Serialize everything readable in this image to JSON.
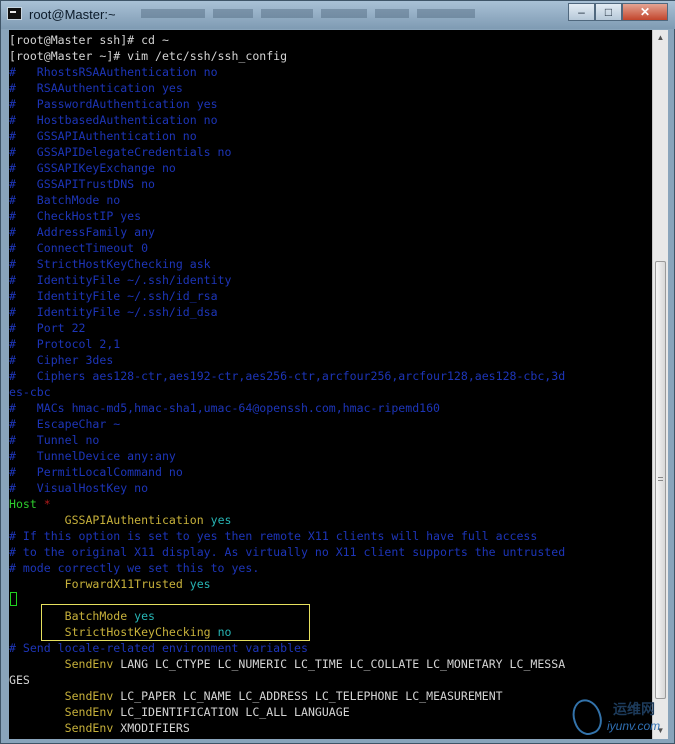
{
  "window": {
    "title": "root@Master:~"
  },
  "controls": {
    "minimize": "–",
    "maximize": "□",
    "close": "✕"
  },
  "scrollbar": {
    "up": "▲",
    "down": "▼"
  },
  "terminal": {
    "lines": [
      [
        [
          "w",
          "[root@Master ssh]# cd ~"
        ]
      ],
      [
        [
          "w",
          "[root@Master ~]# vim /etc/ssh/ssh_config"
        ]
      ],
      [
        [
          "c",
          "#   RhostsRSAAuthentication no"
        ]
      ],
      [
        [
          "c",
          "#   RSAAuthentication yes"
        ]
      ],
      [
        [
          "c",
          "#   PasswordAuthentication yes"
        ]
      ],
      [
        [
          "c",
          "#   HostbasedAuthentication no"
        ]
      ],
      [
        [
          "c",
          "#   GSSAPIAuthentication no"
        ]
      ],
      [
        [
          "c",
          "#   GSSAPIDelegateCredentials no"
        ]
      ],
      [
        [
          "c",
          "#   GSSAPIKeyExchange no"
        ]
      ],
      [
        [
          "c",
          "#   GSSAPITrustDNS no"
        ]
      ],
      [
        [
          "c",
          "#   BatchMode no"
        ]
      ],
      [
        [
          "c",
          "#   CheckHostIP yes"
        ]
      ],
      [
        [
          "c",
          "#   AddressFamily any"
        ]
      ],
      [
        [
          "c",
          "#   ConnectTimeout 0"
        ]
      ],
      [
        [
          "c",
          "#   StrictHostKeyChecking ask"
        ]
      ],
      [
        [
          "c",
          "#   IdentityFile ~/.ssh/identity"
        ]
      ],
      [
        [
          "c",
          "#   IdentityFile ~/.ssh/id_rsa"
        ]
      ],
      [
        [
          "c",
          "#   IdentityFile ~/.ssh/id_dsa"
        ]
      ],
      [
        [
          "c",
          "#   Port 22"
        ]
      ],
      [
        [
          "c",
          "#   Protocol 2,1"
        ]
      ],
      [
        [
          "c",
          "#   Cipher 3des"
        ]
      ],
      [
        [
          "c",
          "#   Ciphers aes128-ctr,aes192-ctr,aes256-ctr,arcfour256,arcfour128,aes128-cbc,3d"
        ]
      ],
      [
        [
          "c",
          "es-cbc"
        ]
      ],
      [
        [
          "c",
          "#   MACs hmac-md5,hmac-sha1,umac-64@openssh.com,hmac-ripemd160"
        ]
      ],
      [
        [
          "c",
          "#   EscapeChar ~"
        ]
      ],
      [
        [
          "c",
          "#   Tunnel no"
        ]
      ],
      [
        [
          "c",
          "#   TunnelDevice any:any"
        ]
      ],
      [
        [
          "c",
          "#   PermitLocalCommand no"
        ]
      ],
      [
        [
          "c",
          "#   VisualHostKey no"
        ]
      ],
      [
        [
          "g",
          "Host "
        ],
        [
          "r",
          "*"
        ]
      ],
      [
        [
          "w",
          "        "
        ],
        [
          "y",
          "GSSAPIAuthentication"
        ],
        [
          "w",
          " "
        ],
        [
          "t",
          "yes"
        ]
      ],
      [
        [
          "c",
          "# If this option is set to yes then remote X11 clients will have full access"
        ]
      ],
      [
        [
          "c",
          "# to the original X11 display. As virtually no X11 client supports the untrusted"
        ]
      ],
      [
        [
          "c",
          "# mode correctly we set this to yes."
        ]
      ],
      [
        [
          "w",
          "        "
        ],
        [
          "y",
          "ForwardX11Trusted"
        ],
        [
          "w",
          " "
        ],
        [
          "t",
          "yes"
        ]
      ],
      [
        [
          "w",
          ""
        ]
      ],
      [
        [
          "w",
          "        "
        ],
        [
          "y",
          "BatchMode"
        ],
        [
          "w",
          " "
        ],
        [
          "t",
          "yes"
        ]
      ],
      [
        [
          "w",
          "        "
        ],
        [
          "y",
          "StrictHostKeyChecking"
        ],
        [
          "w",
          " "
        ],
        [
          "t",
          "no"
        ]
      ],
      [
        [
          "c",
          "# Send locale-related environment variables"
        ]
      ],
      [
        [
          "w",
          "        "
        ],
        [
          "y",
          "SendEnv"
        ],
        [
          "w",
          " LANG LC_CTYPE LC_NUMERIC LC_TIME LC_COLLATE LC_MONETARY LC_MESSA"
        ]
      ],
      [
        [
          "w",
          "GES"
        ]
      ],
      [
        [
          "w",
          "        "
        ],
        [
          "y",
          "SendEnv"
        ],
        [
          "w",
          " LC_PAPER LC_NAME LC_ADDRESS LC_TELEPHONE LC_MEASUREMENT"
        ]
      ],
      [
        [
          "w",
          "        "
        ],
        [
          "y",
          "SendEnv"
        ],
        [
          "w",
          " LC_IDENTIFICATION LC_ALL LANGUAGE"
        ]
      ],
      [
        [
          "w",
          "        "
        ],
        [
          "y",
          "SendEnv"
        ],
        [
          "w",
          " XMODIFIERS"
        ]
      ]
    ]
  },
  "watermark": {
    "cn": "运维网",
    "en": "iyunv.com"
  },
  "colors": {
    "comment": "#1d35b8",
    "keyword": "#c7b13b",
    "value": "#27b5b5",
    "host": "#2dcc2d",
    "star": "#b61b1b",
    "text": "#d4d4d4"
  }
}
